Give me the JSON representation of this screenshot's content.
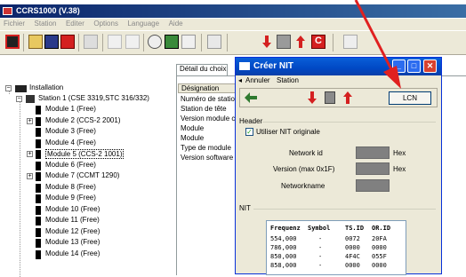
{
  "main_window": {
    "title": "CCRS1000 (V.38)",
    "menu": [
      "Fichier",
      "Station",
      "Editer",
      "Options",
      "Language",
      "Aide"
    ]
  },
  "tree": {
    "root": "Installation",
    "station": "Station 1 (CSE 3319,STC 316/332)",
    "modules": [
      {
        "label": "Module 1 (Free)",
        "expander": false,
        "selected": false
      },
      {
        "label": "Module 2 (CCS-2 2001)",
        "expander": true,
        "selected": false
      },
      {
        "label": "Module 3 (Free)",
        "expander": false,
        "selected": false
      },
      {
        "label": "Module 4 (Free)",
        "expander": false,
        "selected": false
      },
      {
        "label": "Module 5 (CCS-2 1001)",
        "expander": true,
        "selected": true
      },
      {
        "label": "Module 6 (Free)",
        "expander": false,
        "selected": false
      },
      {
        "label": "Module 7 (CCMT 1290)",
        "expander": true,
        "selected": false
      },
      {
        "label": "Module 8 (Free)",
        "expander": false,
        "selected": false
      },
      {
        "label": "Module 9 (Free)",
        "expander": false,
        "selected": false
      },
      {
        "label": "Module 10 (Free)",
        "expander": false,
        "selected": false
      },
      {
        "label": "Module 11 (Free)",
        "expander": false,
        "selected": false
      },
      {
        "label": "Module 12 (Free)",
        "expander": false,
        "selected": false
      },
      {
        "label": "Module 13 (Free)",
        "expander": false,
        "selected": false
      },
      {
        "label": "Module 14 (Free)",
        "expander": false,
        "selected": false
      }
    ]
  },
  "detail": {
    "tab": "Détail du choix",
    "header": "Désignation",
    "rows": [
      "Numéro de statio",
      "Station de tête",
      "Version module c",
      "Module",
      "Module",
      "Type de module",
      "Version software"
    ]
  },
  "dialog": {
    "title": "Créer NIT",
    "menu": {
      "cancel": "Annuler",
      "station": "Station"
    },
    "lcn_button": "LCN",
    "header_group": "Header",
    "use_original_nit": {
      "label": "Utiliser NIT originale",
      "checked": true
    },
    "fields": [
      {
        "label": "Network id",
        "unit": "Hex"
      },
      {
        "label": "Version (max 0x1F)",
        "unit": "Hex"
      },
      {
        "label": "Networkname",
        "unit": ""
      }
    ],
    "nit_group": "NIT",
    "nit_table": {
      "columns": [
        "Frequenz",
        "Symbol",
        "TS.ID",
        "OR.ID"
      ],
      "rows": [
        [
          "554,000",
          "-",
          "0072",
          "20FA"
        ],
        [
          "786,000",
          "-",
          "0000",
          "0000"
        ],
        [
          "850,000",
          "-",
          "4F4C",
          "055F"
        ],
        [
          "858,000",
          "-",
          "0000",
          "0000"
        ]
      ]
    }
  },
  "colors": {
    "titlebar": "#0048c4",
    "close_button": "#d8412f",
    "arrow": "#e02020",
    "toolbar_icon_red": "#d42020"
  }
}
